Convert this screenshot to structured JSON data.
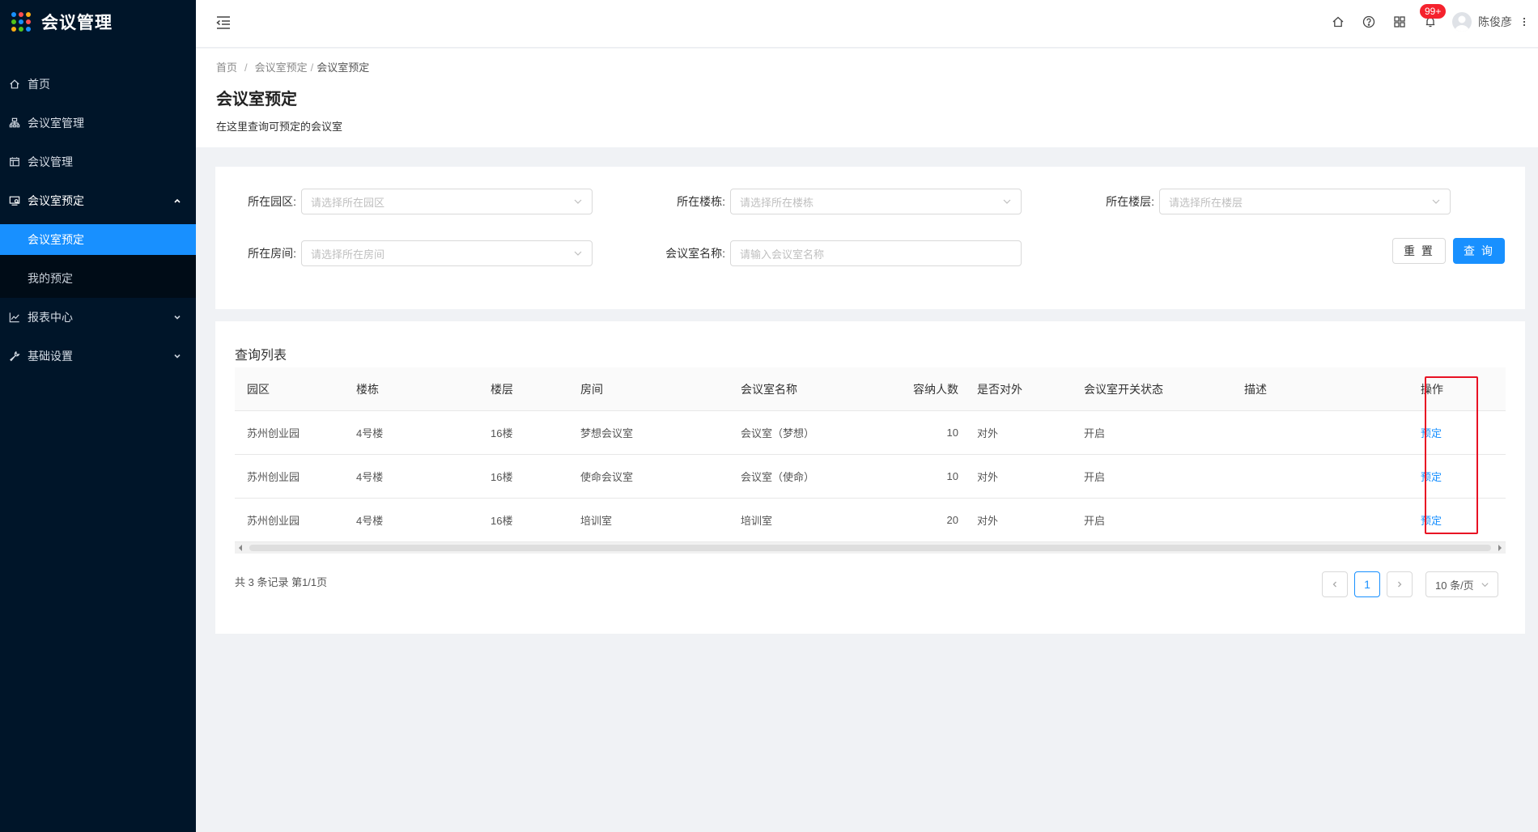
{
  "app": {
    "title": "会议管理"
  },
  "sidebar": {
    "items": [
      {
        "label": "首页",
        "icon": "home-icon"
      },
      {
        "label": "会议室管理",
        "icon": "room-icon"
      },
      {
        "label": "会议管理",
        "icon": "meeting-icon"
      },
      {
        "label": "会议室预定",
        "icon": "booking-icon",
        "expanded": true,
        "children": [
          {
            "label": "会议室预定",
            "active": true
          },
          {
            "label": "我的预定"
          }
        ]
      },
      {
        "label": "报表中心",
        "icon": "chart-icon"
      },
      {
        "label": "基础设置",
        "icon": "wrench-icon"
      }
    ]
  },
  "header": {
    "badge": "99+",
    "username": "陈俊彦"
  },
  "breadcrumb": [
    "首页",
    "会议室预定",
    "会议室预定"
  ],
  "page": {
    "title": "会议室预定",
    "description": "在这里查询可预定的会议室"
  },
  "filters": {
    "park": {
      "label": "所在园区:",
      "placeholder": "请选择所在园区"
    },
    "building": {
      "label": "所在楼栋:",
      "placeholder": "请选择所在楼栋"
    },
    "floor": {
      "label": "所在楼层:",
      "placeholder": "请选择所在楼层"
    },
    "room": {
      "label": "所在房间:",
      "placeholder": "请选择所在房间"
    },
    "name": {
      "label": "会议室名称:",
      "placeholder": "请输入会议室名称"
    },
    "reset_label": "重 置",
    "query_label": "查 询"
  },
  "table": {
    "title": "查询列表",
    "columns": [
      "园区",
      "楼栋",
      "楼层",
      "房间",
      "会议室名称",
      "容纳人数",
      "是否对外",
      "会议室开关状态",
      "描述",
      "操作"
    ],
    "rows": [
      [
        "苏州创业园",
        "4号楼",
        "16楼",
        "梦想会议室",
        "会议室（梦想）",
        "10",
        "对外",
        "开启",
        "",
        "预定"
      ],
      [
        "苏州创业园",
        "4号楼",
        "16楼",
        "使命会议室",
        "会议室（使命）",
        "10",
        "对外",
        "开启",
        "",
        "预定"
      ],
      [
        "苏州创业园",
        "4号楼",
        "16楼",
        "培训室",
        "培训室",
        "20",
        "对外",
        "开启",
        "",
        "预定"
      ]
    ]
  },
  "pagination": {
    "total_text": "共 3 条记录 第1/1页",
    "current_page": "1",
    "page_size": "10 条/页"
  },
  "colors": {
    "sidebar_bg": "#001529",
    "accent": "#1890ff",
    "badge": "#f5222d",
    "highlight_frame": "#e81123"
  }
}
